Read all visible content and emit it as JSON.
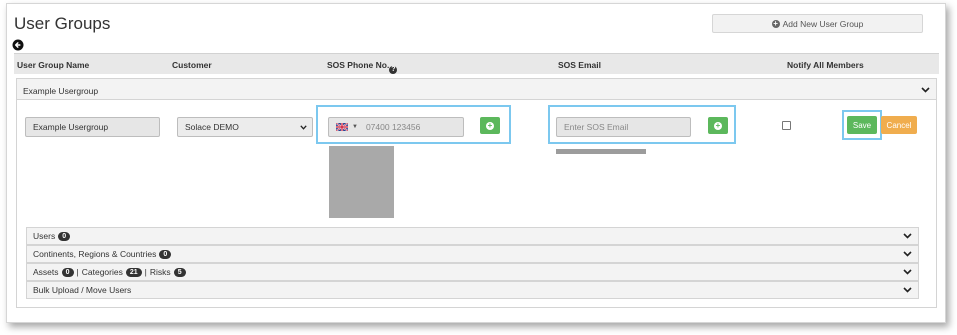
{
  "page": {
    "title": "User Groups",
    "add_group_button": "Add New User Group"
  },
  "table": {
    "columns": {
      "name": "User Group Name",
      "customer": "Customer",
      "phone": "SOS Phone No.",
      "email": "SOS Email",
      "notify": "Notify All Members"
    }
  },
  "group": {
    "header_label": "Example Usergroup",
    "name_value": "Example Usergroup",
    "customer_selected": "Solace DEMO",
    "phone_placeholder": "07400 123456",
    "email_placeholder": "Enter SOS Email",
    "notify_checked": false,
    "save_label": "Save",
    "cancel_label": "Cancel"
  },
  "sections": {
    "users": {
      "label": "Users",
      "count": "0"
    },
    "continents": {
      "label": "Continents, Regions & Countries",
      "count": "0"
    },
    "assets": {
      "assets_label": "Assets",
      "assets_count": "0",
      "separator": "|",
      "categories_label": "Categories",
      "categories_count": "21",
      "risks_label": "Risks",
      "risks_count": "5"
    },
    "bulk": {
      "label": "Bulk Upload / Move Users"
    }
  },
  "icons": {
    "back": "arrow-left-circle-icon",
    "add": "plus-circle-icon",
    "help": "question-circle-icon",
    "chevron": "chevron-down-icon",
    "flag": "uk-flag-icon"
  },
  "colors": {
    "save": "#5cb85c",
    "cancel": "#f0ad4e",
    "highlight": "#7cc8ef",
    "header_bg": "#e8e8e8"
  }
}
